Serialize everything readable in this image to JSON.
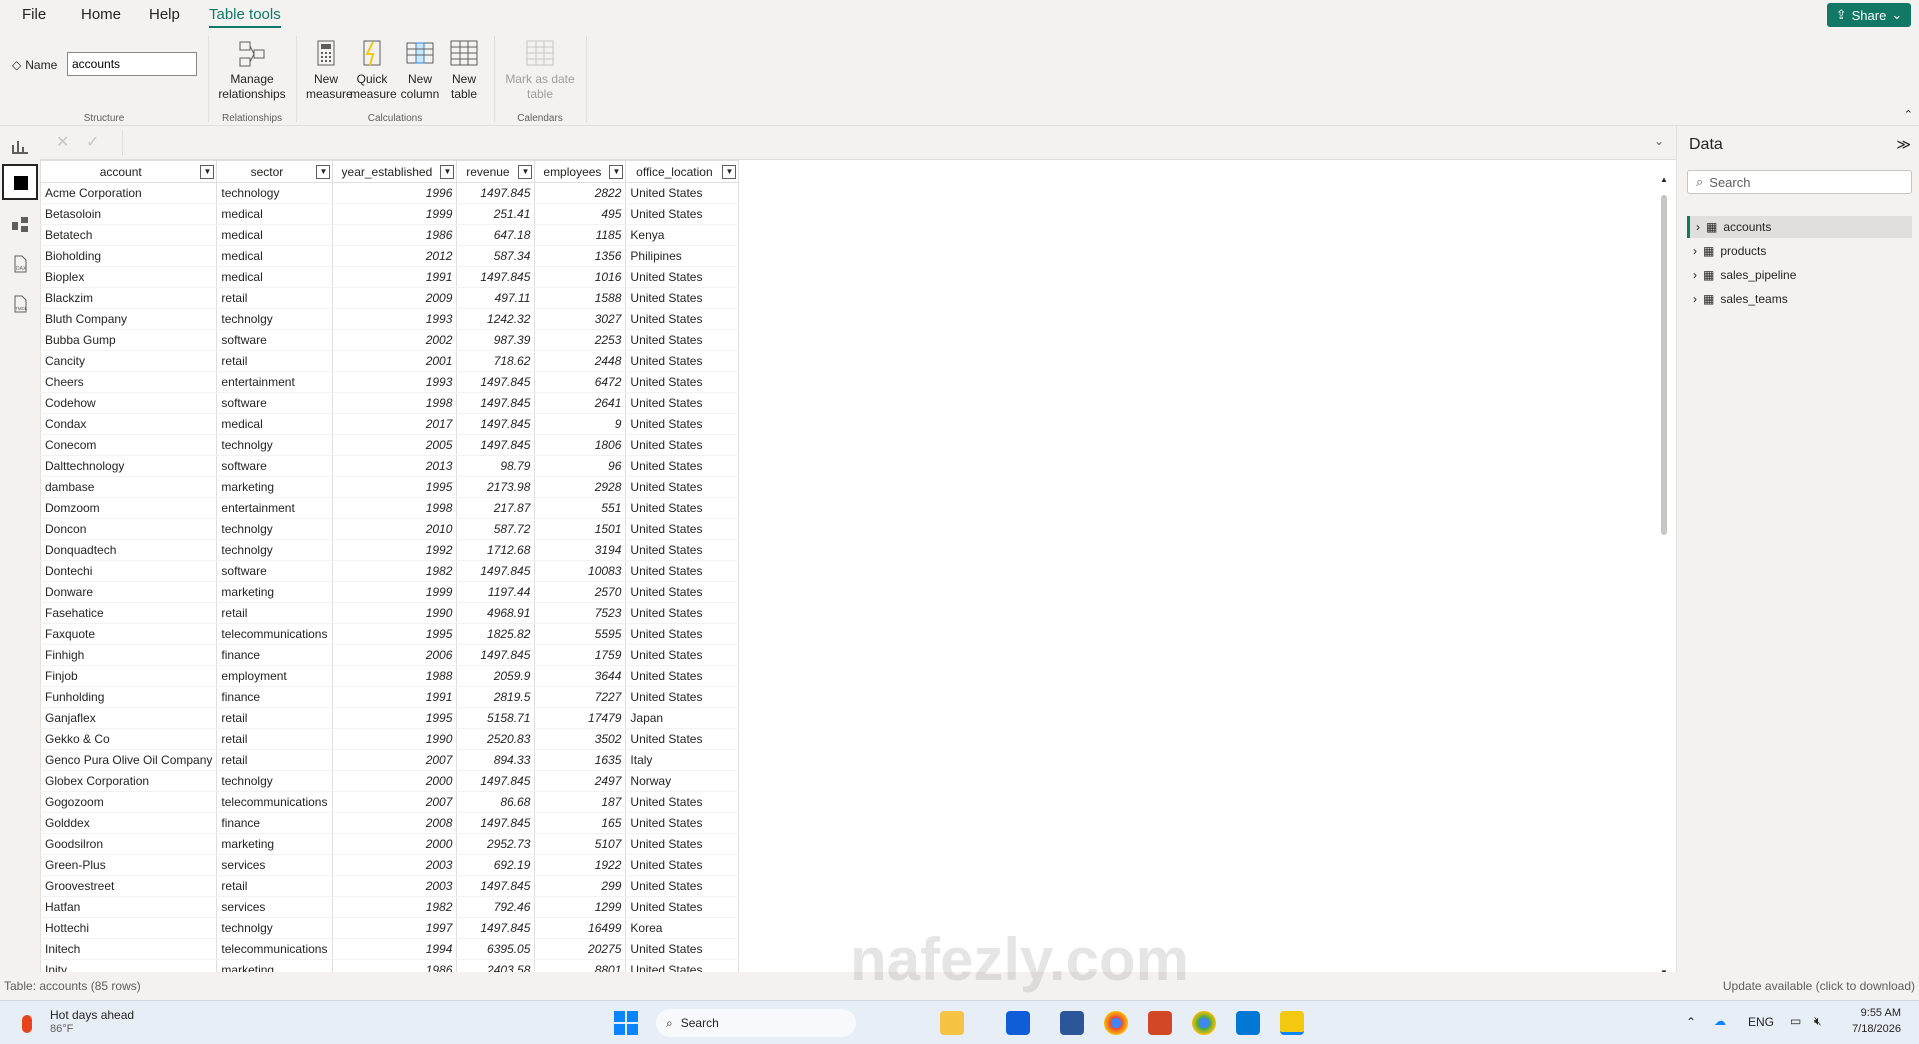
{
  "menu": {
    "file": "File",
    "home": "Home",
    "help": "Help",
    "table_tools": "Table tools",
    "share": "Share"
  },
  "ribbon": {
    "name_label": "Name",
    "name_value": "accounts",
    "structure_label": "Structure",
    "manage_relationships": "Manage relationships",
    "relationships_label": "Relationships",
    "new_measure": "New measure",
    "quick_measure": "Quick measure",
    "new_column": "New column",
    "new_table": "New table",
    "calculations_label": "Calculations",
    "mark_as_date_table": "Mark as date table",
    "calendars_label": "Calendars"
  },
  "table": {
    "columns": [
      "account",
      "sector",
      "year_established",
      "revenue",
      "employees",
      "office_location"
    ],
    "rows": [
      [
        "Acme Corporation",
        "technology",
        "1996",
        "1497.845",
        "2822",
        "United States"
      ],
      [
        "Betasoloin",
        "medical",
        "1999",
        "251.41",
        "495",
        "United States"
      ],
      [
        "Betatech",
        "medical",
        "1986",
        "647.18",
        "1185",
        "Kenya"
      ],
      [
        "Bioholding",
        "medical",
        "2012",
        "587.34",
        "1356",
        "Philipines"
      ],
      [
        "Bioplex",
        "medical",
        "1991",
        "1497.845",
        "1016",
        "United States"
      ],
      [
        "Blackzim",
        "retail",
        "2009",
        "497.11",
        "1588",
        "United States"
      ],
      [
        "Bluth Company",
        "technolgy",
        "1993",
        "1242.32",
        "3027",
        "United States"
      ],
      [
        "Bubba Gump",
        "software",
        "2002",
        "987.39",
        "2253",
        "United States"
      ],
      [
        "Cancity",
        "retail",
        "2001",
        "718.62",
        "2448",
        "United States"
      ],
      [
        "Cheers",
        "entertainment",
        "1993",
        "1497.845",
        "6472",
        "United States"
      ],
      [
        "Codehow",
        "software",
        "1998",
        "1497.845",
        "2641",
        "United States"
      ],
      [
        "Condax",
        "medical",
        "2017",
        "1497.845",
        "9",
        "United States"
      ],
      [
        "Conecom",
        "technolgy",
        "2005",
        "1497.845",
        "1806",
        "United States"
      ],
      [
        "Dalttechnology",
        "software",
        "2013",
        "98.79",
        "96",
        "United States"
      ],
      [
        "dambase",
        "marketing",
        "1995",
        "2173.98",
        "2928",
        "United States"
      ],
      [
        "Domzoom",
        "entertainment",
        "1998",
        "217.87",
        "551",
        "United States"
      ],
      [
        "Doncon",
        "technolgy",
        "2010",
        "587.72",
        "1501",
        "United States"
      ],
      [
        "Donquadtech",
        "technolgy",
        "1992",
        "1712.68",
        "3194",
        "United States"
      ],
      [
        "Dontechi",
        "software",
        "1982",
        "1497.845",
        "10083",
        "United States"
      ],
      [
        "Donware",
        "marketing",
        "1999",
        "1197.44",
        "2570",
        "United States"
      ],
      [
        "Fasehatice",
        "retail",
        "1990",
        "4968.91",
        "7523",
        "United States"
      ],
      [
        "Faxquote",
        "telecommunications",
        "1995",
        "1825.82",
        "5595",
        "United States"
      ],
      [
        "Finhigh",
        "finance",
        "2006",
        "1497.845",
        "1759",
        "United States"
      ],
      [
        "Finjob",
        "employment",
        "1988",
        "2059.9",
        "3644",
        "United States"
      ],
      [
        "Funholding",
        "finance",
        "1991",
        "2819.5",
        "7227",
        "United States"
      ],
      [
        "Ganjaflex",
        "retail",
        "1995",
        "5158.71",
        "17479",
        "Japan"
      ],
      [
        "Gekko & Co",
        "retail",
        "1990",
        "2520.83",
        "3502",
        "United States"
      ],
      [
        "Genco Pura Olive Oil Company",
        "retail",
        "2007",
        "894.33",
        "1635",
        "Italy"
      ],
      [
        "Globex Corporation",
        "technolgy",
        "2000",
        "1497.845",
        "2497",
        "Norway"
      ],
      [
        "Gogozoom",
        "telecommunications",
        "2007",
        "86.68",
        "187",
        "United States"
      ],
      [
        "Golddex",
        "finance",
        "2008",
        "1497.845",
        "165",
        "United States"
      ],
      [
        "Goodsilron",
        "marketing",
        "2000",
        "2952.73",
        "5107",
        "United States"
      ],
      [
        "Green-Plus",
        "services",
        "2003",
        "692.19",
        "1922",
        "United States"
      ],
      [
        "Groovestreet",
        "retail",
        "2003",
        "1497.845",
        "299",
        "United States"
      ],
      [
        "Hatfan",
        "services",
        "1982",
        "792.46",
        "1299",
        "United States"
      ],
      [
        "Hottechi",
        "technolgy",
        "1997",
        "1497.845",
        "16499",
        "Korea"
      ],
      [
        "Initech",
        "telecommunications",
        "1994",
        "6395.05",
        "20275",
        "United States"
      ],
      [
        "Inity",
        "marketing",
        "1986",
        "2403.58",
        "8801",
        "United States"
      ]
    ]
  },
  "data_pane": {
    "title": "Data",
    "search_placeholder": "Search",
    "tables": [
      "accounts",
      "products",
      "sales_pipeline",
      "sales_teams"
    ]
  },
  "status": {
    "left": "Table: accounts (85 rows)",
    "right": "Update available (click to download)"
  },
  "taskbar": {
    "weather_title": "Hot days ahead",
    "weather_temp": "86°F",
    "search": "Search",
    "lang": "ENG",
    "time": "9:55 AM",
    "date": "7/18/2026"
  },
  "watermark": "nafezly.com"
}
